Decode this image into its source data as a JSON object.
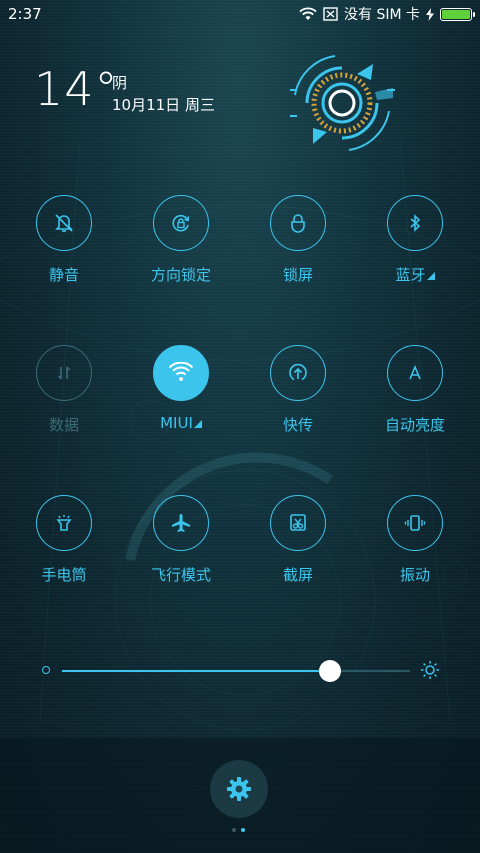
{
  "status_bar": {
    "time": "2:37",
    "sim_text": "没有 SIM 卡",
    "battery_level": 1.0
  },
  "weather": {
    "temperature": "14°",
    "condition": "阴",
    "date": "10月11日 周三"
  },
  "toggles": [
    {
      "label": "静音",
      "icon": "bell-off-icon",
      "state": "off"
    },
    {
      "label": "方向锁定",
      "icon": "rotation-lock-icon",
      "state": "off"
    },
    {
      "label": "锁屏",
      "icon": "lock-icon",
      "state": "off"
    },
    {
      "label": "蓝牙",
      "icon": "bluetooth-icon",
      "state": "off",
      "has_menu": true
    },
    {
      "label": "数据",
      "icon": "mobile-data-icon",
      "state": "disabled"
    },
    {
      "label": "MIUI",
      "icon": "wifi-icon",
      "state": "on",
      "has_menu": true
    },
    {
      "label": "快传",
      "icon": "quick-share-icon",
      "state": "off"
    },
    {
      "label": "自动亮度",
      "icon": "auto-brightness-icon",
      "state": "off"
    },
    {
      "label": "手电筒",
      "icon": "flashlight-icon",
      "state": "off"
    },
    {
      "label": "飞行模式",
      "icon": "airplane-icon",
      "state": "off"
    },
    {
      "label": "截屏",
      "icon": "screenshot-icon",
      "state": "off"
    },
    {
      "label": "振动",
      "icon": "vibrate-icon",
      "state": "off"
    }
  ],
  "brightness": {
    "level": 0.77
  },
  "pager": {
    "pages": 2,
    "current": 2
  },
  "colors": {
    "accent": "#3cc5ec",
    "disabled": "#3c6a78",
    "battery": "#5fd13a"
  }
}
